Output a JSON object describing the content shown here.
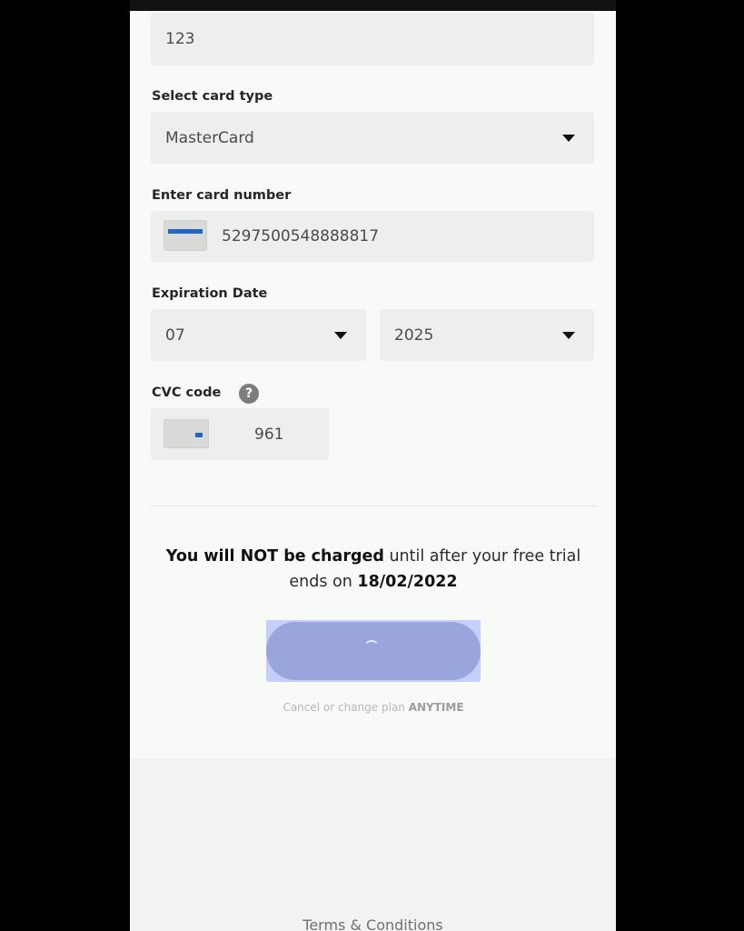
{
  "form": {
    "top_field_value": "123",
    "card_type": {
      "label": "Select card type",
      "value": "MasterCard"
    },
    "card_number": {
      "label": "Enter card number",
      "value": "5297500548888817"
    },
    "expiration": {
      "label": "Expiration Date",
      "month": "07",
      "year": "2025"
    },
    "cvc": {
      "label": "CVC code",
      "help_glyph": "?",
      "value": "961"
    }
  },
  "notice": {
    "bold_part": "You will NOT be charged",
    "normal_part": " until after your free trial ends on ",
    "date": "18/02/2022"
  },
  "cancel": {
    "text": "Cancel or change plan ",
    "bold": "ANYTIME"
  },
  "footer": {
    "terms_link": "Terms & Conditions"
  },
  "colors": {
    "submit_button": "#9aa5dc",
    "accent_blue": "#1e67c8"
  }
}
